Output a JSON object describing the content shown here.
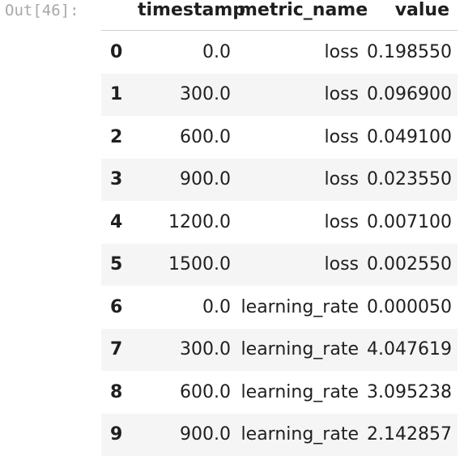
{
  "cell": {
    "prompt": "Out[46]:"
  },
  "table": {
    "columns": [
      "",
      "timestamp",
      "metric_name",
      "value"
    ],
    "rows": [
      {
        "index": "0",
        "timestamp": "0.0",
        "metric_name": "loss",
        "value": "0.198550"
      },
      {
        "index": "1",
        "timestamp": "300.0",
        "metric_name": "loss",
        "value": "0.096900"
      },
      {
        "index": "2",
        "timestamp": "600.0",
        "metric_name": "loss",
        "value": "0.049100"
      },
      {
        "index": "3",
        "timestamp": "900.0",
        "metric_name": "loss",
        "value": "0.023550"
      },
      {
        "index": "4",
        "timestamp": "1200.0",
        "metric_name": "loss",
        "value": "0.007100"
      },
      {
        "index": "5",
        "timestamp": "1500.0",
        "metric_name": "loss",
        "value": "0.002550"
      },
      {
        "index": "6",
        "timestamp": "0.0",
        "metric_name": "learning_rate",
        "value": "0.000050"
      },
      {
        "index": "7",
        "timestamp": "300.0",
        "metric_name": "learning_rate",
        "value": "4.047619"
      },
      {
        "index": "8",
        "timestamp": "600.0",
        "metric_name": "learning_rate",
        "value": "3.095238"
      },
      {
        "index": "9",
        "timestamp": "900.0",
        "metric_name": "learning_rate",
        "value": "2.142857"
      }
    ]
  },
  "colors": {
    "prompt": "#a8a8a8",
    "stripe": "#f5f5f5",
    "text": "#1f1f1f"
  }
}
